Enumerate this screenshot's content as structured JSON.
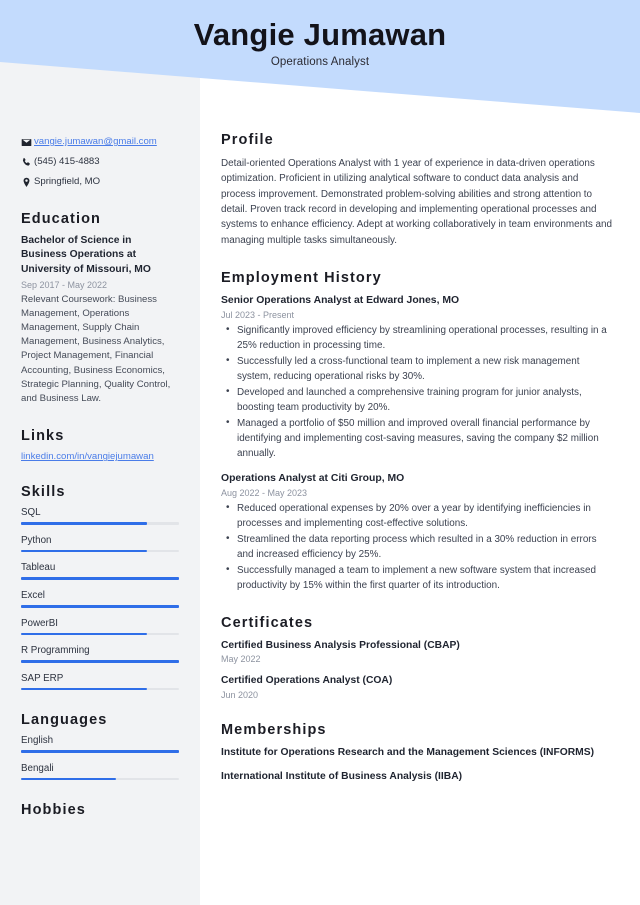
{
  "header": {
    "name": "Vangie Jumawan",
    "job_title": "Operations Analyst",
    "banner_color": "#C3DBFD"
  },
  "sidebar": {
    "contact": {
      "email": "vangie.jumawan@gmail.com",
      "email_icon": "envelope-icon",
      "phone": "(545) 415-4883",
      "phone_icon": "phone-icon",
      "location": "Springfield, MO",
      "location_icon": "map-pin-icon"
    },
    "education": {
      "heading": "Education",
      "degree": "Bachelor of Science in Business Operations at University of Missouri, MO",
      "date": "Sep 2017 - May 2022",
      "description": "Relevant Coursework: Business Management, Operations Management, Supply Chain Management, Business Analytics, Project Management, Financial Accounting, Business Economics, Strategic Planning, Quality Control, and Business Law."
    },
    "links": {
      "heading": "Links",
      "items": [
        {
          "label": "linkedin.com/in/vangiejumawan"
        }
      ]
    },
    "skills": {
      "heading": "Skills",
      "items": [
        {
          "label": "SQL",
          "level": 80
        },
        {
          "label": "Python",
          "level": 80
        },
        {
          "label": "Tableau",
          "level": 100
        },
        {
          "label": "Excel",
          "level": 100
        },
        {
          "label": "PowerBI",
          "level": 80
        },
        {
          "label": "R Programming",
          "level": 100
        },
        {
          "label": "SAP ERP",
          "level": 80
        }
      ]
    },
    "languages": {
      "heading": "Languages",
      "items": [
        {
          "label": "English",
          "level": 100
        },
        {
          "label": "Bengali",
          "level": 60
        }
      ]
    },
    "hobbies": {
      "heading": "Hobbies"
    },
    "accent_color": "#2f6ee8",
    "link_color": "#4a7ce8",
    "background_color": "#F2F3F5"
  },
  "main": {
    "profile": {
      "heading": "Profile",
      "text": "Detail-oriented Operations Analyst with 1 year of experience in data-driven operations optimization. Proficient in utilizing analytical software to conduct data analysis and process improvement. Demonstrated problem-solving abilities and strong attention to detail. Proven track record in developing and implementing operational processes and systems to enhance efficiency. Adept at working collaboratively in team environments and managing multiple tasks simultaneously."
    },
    "employment": {
      "heading": "Employment History",
      "jobs": [
        {
          "title": "Senior Operations Analyst at Edward Jones, MO",
          "date": "Jul 2023 - Present",
          "bullets": [
            "Significantly improved efficiency by streamlining operational processes, resulting in a 25% reduction in processing time.",
            "Successfully led a cross-functional team to implement a new risk management system, reducing operational risks by 30%.",
            "Developed and launched a comprehensive training program for junior analysts, boosting team productivity by 20%.",
            "Managed a portfolio of $50 million and improved overall financial performance by identifying and implementing cost-saving measures, saving the company $2 million annually."
          ]
        },
        {
          "title": "Operations Analyst at Citi Group, MO",
          "date": "Aug 2022 - May 2023",
          "bullets": [
            "Reduced operational expenses by 20% over a year by identifying inefficiencies in processes and implementing cost-effective solutions.",
            "Streamlined the data reporting process which resulted in a 30% reduction in errors and increased efficiency by 25%.",
            "Successfully managed a team to implement a new software system that increased productivity by 15% within the first quarter of its introduction."
          ]
        }
      ]
    },
    "certificates": {
      "heading": "Certificates",
      "items": [
        {
          "name": "Certified Business Analysis Professional (CBAP)",
          "date": "May 2022"
        },
        {
          "name": "Certified Operations Analyst (COA)",
          "date": "Jun 2020"
        }
      ]
    },
    "memberships": {
      "heading": "Memberships",
      "items": [
        {
          "name": "Institute for Operations Research and the Management Sciences (INFORMS)"
        },
        {
          "name": "International Institute of Business Analysis (IIBA)"
        }
      ]
    }
  }
}
